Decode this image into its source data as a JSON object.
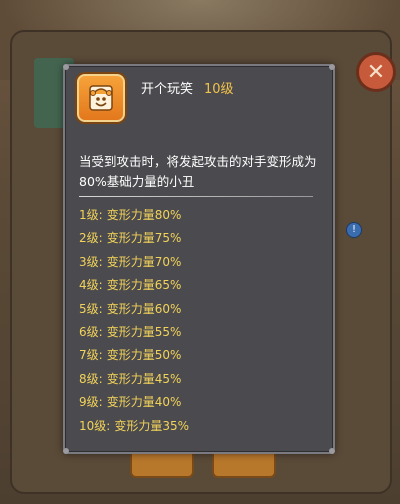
{
  "tooltip": {
    "skill_name": "开个玩笑",
    "skill_level": "10级",
    "description": "当受到攻击时，将发起攻击的对手变形成为80%基础力量的小丑",
    "levels": [
      {
        "level": "1级:",
        "effect": "变形力量80%"
      },
      {
        "level": "2级:",
        "effect": "变形力量75%"
      },
      {
        "level": "3级:",
        "effect": "变形力量70%"
      },
      {
        "level": "4级:",
        "effect": "变形力量65%"
      },
      {
        "level": "5级:",
        "effect": "变形力量60%"
      },
      {
        "level": "6级:",
        "effect": "变形力量55%"
      },
      {
        "level": "7级:",
        "effect": "变形力量50%"
      },
      {
        "level": "8级:",
        "effect": "变形力量45%"
      },
      {
        "level": "9级:",
        "effect": "变形力量40%"
      },
      {
        "level": "10级:",
        "effect": "变形力量35%"
      }
    ]
  },
  "icons": {
    "close": "close-icon",
    "skill": "jester-skill-icon",
    "info": "info-icon"
  },
  "colors": {
    "panel_bg": "#4b4a4e",
    "level_text": "#f2d35a",
    "accent": "#f2c34a",
    "close_button": "#c65a3a"
  }
}
